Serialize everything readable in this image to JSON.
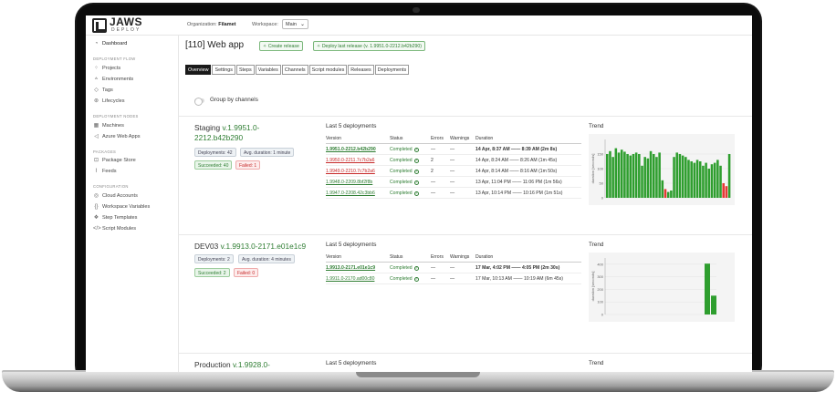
{
  "header": {
    "logo_text": "JAWS",
    "logo_sub": "DEPLOY",
    "org_label": "Organization:",
    "org_value": "Filamet",
    "workspace_label": "Workspace:",
    "workspace_value": "Main"
  },
  "sidebar": {
    "dashboard": "Dashboard",
    "head_deploy": "DEPLOYMENT FLOW",
    "projects": "Projects",
    "environments": "Environments",
    "tags": "Tags",
    "lifecycles": "Lifecycles",
    "head_nodes": "DEPLOYMENT NODES",
    "machines": "Machines",
    "azure": "Azure Web Apps",
    "head_packages": "PACKAGES",
    "package_store": "Package Store",
    "feeds": "Feeds",
    "head_config": "CONFIGURATION",
    "cloud_accounts": "Cloud Accounts",
    "workspace_variables": "Workspace Variables",
    "step_templates": "Step Templates",
    "script_modules": "Script Modules"
  },
  "main": {
    "title": "[110] Web app",
    "create_release": "Create release",
    "deploy_last": "Deploy last release (v. 1.9951.0-2212.b42b290)",
    "tabs": [
      "Overview",
      "Settings",
      "Steps",
      "Variables",
      "Channels",
      "Script modules",
      "Releases",
      "Deployments"
    ],
    "group_by": "Group by channels",
    "last5_label": "Last 5 deployments",
    "trend_label": "Trend",
    "col_version": "Version",
    "col_status": "Status",
    "col_errors": "Errors",
    "col_warnings": "Warnings",
    "col_duration": "Duration",
    "y_axis_label": "duration [seconds]"
  },
  "environments": [
    {
      "name": "Staging",
      "version_line1": "v.1.9951.0-",
      "version_line2": "2212.b42b290",
      "deployments": "Deployments: 42",
      "avg": "Avg. duration: 1 minute",
      "succeeded": "Succeeded: 40",
      "failed": "Failed: 1",
      "rows": [
        {
          "version": "1.9951.0-2212.b42b290",
          "status": "Completed",
          "ok": true,
          "errors": "—",
          "warnings": "—",
          "duration": "14 Apr, 8:37 AM —— 8:39 AM (2m 8s)",
          "bold": true
        },
        {
          "version": "1.9950.0-2211.7c7b2a6",
          "status": "Completed",
          "ok": false,
          "errors": "2",
          "warnings": "—",
          "duration": "14 Apr, 8:24 AM —— 8:26 AM (1m 45s)",
          "bold": false
        },
        {
          "version": "1.9949.0-2210.7c7b2a6",
          "status": "Completed",
          "ok": false,
          "errors": "2",
          "warnings": "—",
          "duration": "14 Apr, 8:14 AM —— 8:16 AM (1m 50s)",
          "bold": false
        },
        {
          "version": "1.9948.0-2209.8bf2f8b",
          "status": "Completed",
          "ok": true,
          "errors": "—",
          "warnings": "—",
          "duration": "13 Apr, 11:04 PM —— 11:06 PM (1m 56s)",
          "bold": false
        },
        {
          "version": "1.9947.0-2208.42c3bb6",
          "status": "Completed",
          "ok": true,
          "errors": "—",
          "warnings": "—",
          "duration": "13 Apr, 10:14 PM —— 10:16 PM (1m 51s)",
          "bold": false
        }
      ]
    },
    {
      "name": "DEV03",
      "version_line1": "v.1.9913.0-2171.e01e1c9",
      "version_line2": "",
      "deployments": "Deployments: 2",
      "avg": "Avg. duration: 4 minutes",
      "succeeded": "Succeeded: 2",
      "failed": "Failed: 0",
      "rows": [
        {
          "version": "1.9913.0-2171.e01e1c9",
          "status": "Completed",
          "ok": true,
          "errors": "—",
          "warnings": "—",
          "duration": "17 Mar, 4:02 PM —— 4:05 PM (2m 30s)",
          "bold": true
        },
        {
          "version": "1.9911.0-2170.ad00c80",
          "status": "Completed",
          "ok": true,
          "errors": "—",
          "warnings": "—",
          "duration": "17 Mar, 10:13 AM —— 10:19 AM (6m 45s)",
          "bold": false
        }
      ]
    },
    {
      "name": "Production",
      "version_line1": "v.1.9928.0-",
      "version_line2": ""
    }
  ],
  "chart_data": [
    {
      "type": "bar",
      "ylabel": "duration [seconds]",
      "yticks": [
        0,
        50,
        100,
        150
      ],
      "ylim": [
        0,
        200
      ],
      "values": [
        150,
        160,
        140,
        170,
        155,
        165,
        158,
        150,
        145,
        150,
        155,
        150,
        110,
        140,
        135,
        160,
        150,
        140,
        155,
        60,
        30,
        20,
        25,
        140,
        155,
        150,
        145,
        140,
        130,
        125,
        120,
        130,
        125,
        110,
        120,
        100,
        115,
        120,
        130,
        110,
        50,
        40,
        150
      ],
      "bar_colors": [
        "green",
        "green",
        "green",
        "green",
        "green",
        "green",
        "green",
        "green",
        "green",
        "green",
        "green",
        "green",
        "green",
        "green",
        "green",
        "green",
        "green",
        "green",
        "green",
        "green",
        "red",
        "green",
        "green",
        "green",
        "green",
        "green",
        "green",
        "green",
        "green",
        "green",
        "green",
        "green",
        "green",
        "green",
        "green",
        "green",
        "green",
        "green",
        "green",
        "green",
        "red",
        "red",
        "green"
      ]
    },
    {
      "type": "bar",
      "ylabel": "duration [seconds]",
      "yticks": [
        0,
        100,
        200,
        300,
        400
      ],
      "ylim": [
        0,
        450
      ],
      "values": [
        405,
        150
      ],
      "bar_colors": [
        "green",
        "green"
      ]
    }
  ],
  "colors": {
    "accent_green": "#2e7d32",
    "fail_red": "#e53935",
    "bar_green": "#2e9e2e"
  }
}
